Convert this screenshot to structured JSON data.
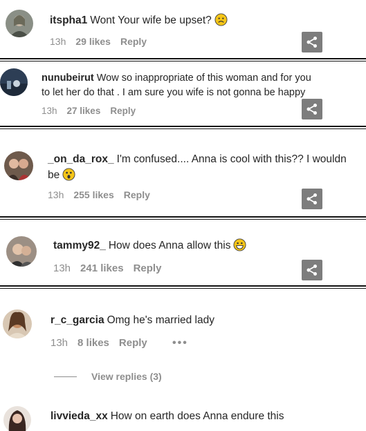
{
  "comments": [
    {
      "username": "itspha1",
      "text": "Wont Your wife be upset?",
      "emoji": "frowning-face",
      "time": "13h",
      "likes": "29 likes",
      "reply": "Reply"
    },
    {
      "username": "nunubeirut",
      "text_line1": "Wow so inappropriate of this woman and for you",
      "text_line2": "to let her do that . I am sure you wife is not gonna be happy",
      "time": "13h",
      "likes": "27 likes",
      "reply": "Reply"
    },
    {
      "username": "_on_da_rox_",
      "text_line1": "I'm confused.... Anna is cool with this?? I wouldn",
      "text_line2": "be",
      "emoji": "astonished-face",
      "time": "13h",
      "likes": "255 likes",
      "reply": "Reply"
    },
    {
      "username": "tammy92_",
      "text": "How does Anna allow this",
      "emoji": "grinning-face",
      "time": "13h",
      "likes": "241 likes",
      "reply": "Reply"
    },
    {
      "username": "r_c_garcia",
      "text": "Omg he's married lady",
      "time": "13h",
      "likes": "8 likes",
      "reply": "Reply",
      "more": "•••",
      "view_replies": "View replies (3)"
    },
    {
      "username": "livvieda_xx",
      "text": "How on earth does Anna endure this"
    }
  ],
  "colors": {
    "text": "#262626",
    "muted": "#8e8e8e",
    "share_button": "#7d7d7d",
    "divider": "#111111"
  },
  "icons": {
    "share": "share-icon"
  }
}
